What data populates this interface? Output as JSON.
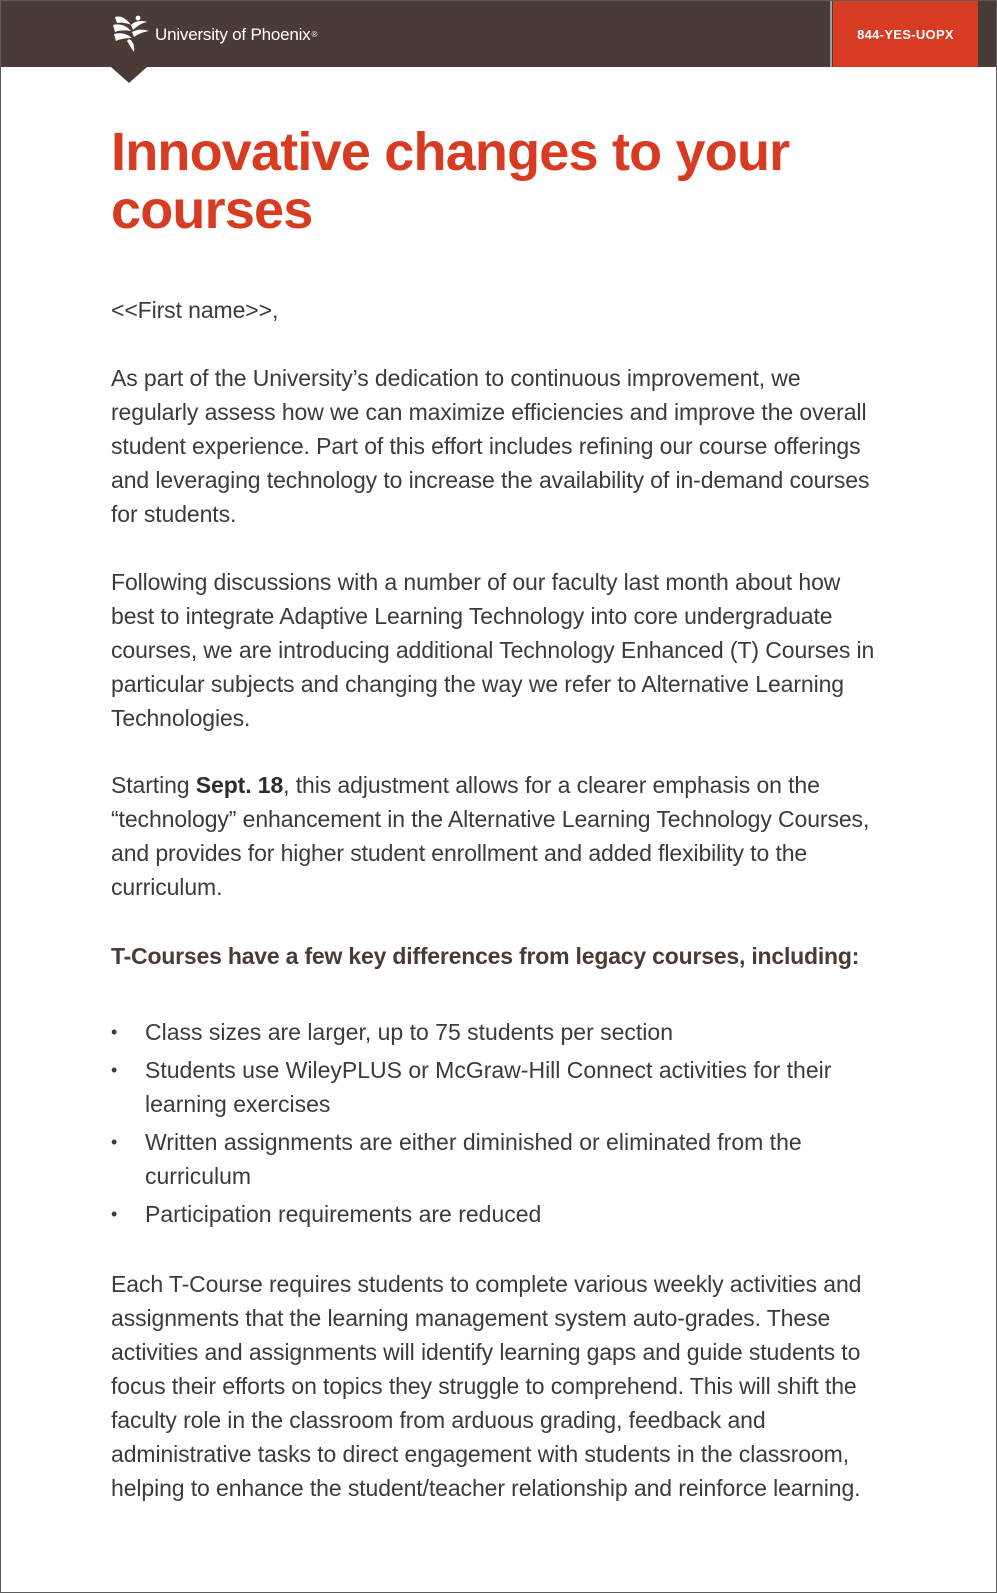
{
  "header": {
    "brand": "University of Phoenix",
    "registered_mark": "®",
    "phone": "844-YES-UOPX",
    "logo_icon": "phoenix-logo-icon"
  },
  "colors": {
    "header_bg": "#4a3b36",
    "accent": "#d73c23",
    "body_text": "#3e3a39"
  },
  "title": "Innovative changes to your courses",
  "greeting": "<<First name>>,",
  "paragraphs": {
    "p1": "As part of the University’s dedication to continuous improvement, we regularly assess how we can maximize efficiencies and improve the overall student experience. Part of this effort includes refining our course offerings and leveraging technology to increase the availability of in-demand courses for students.",
    "p2": "Following discussions with a number of our faculty last month about how best to integrate Adaptive Learning Technology into core undergraduate courses, we are introducing additional Technology Enhanced (T) Courses in particular subjects and changing the way we refer to Alternative Learning Technologies.",
    "p3_before": "Starting ",
    "p3_bold": "Sept. 18",
    "p3_after": ", this adjustment allows for a clearer emphasis on the “technology” enhancement in the Alternative Learning Technology Courses, and provides for higher student enrollment and added flexibility to the curriculum.",
    "p4": "Each T-Course requires students to complete various weekly activities and assignments that the learning management system auto-grades. These activities and assignments will identify learning gaps and guide students to focus their efforts on topics they struggle to comprehend. This will shift the faculty role in the classroom from arduous grading, feedback and administrative tasks to direct engagement with students in the classroom, helping to enhance the student/teacher relationship and reinforce learning."
  },
  "list": {
    "heading": "T-Courses have a few key differences from legacy courses, including:",
    "bullet": "•",
    "items": [
      "Class sizes are larger, up to 75 students per section",
      "Students use WileyPLUS or McGraw-Hill Connect activities for their learning exercises",
      "Written assignments are either diminished or eliminated from the curriculum",
      "Participation requirements are reduced"
    ]
  }
}
